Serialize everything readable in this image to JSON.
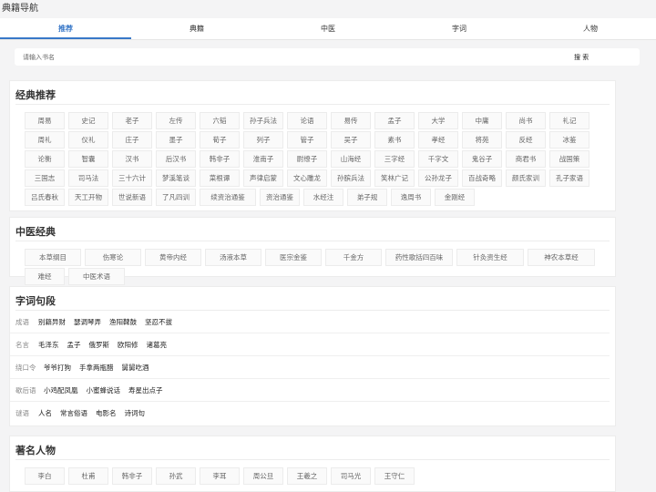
{
  "app": {
    "title": "典籍导航"
  },
  "tabs": [
    {
      "label": "推荐",
      "active": true
    },
    {
      "label": "典籍",
      "active": false
    },
    {
      "label": "中医",
      "active": false
    },
    {
      "label": "字词",
      "active": false
    },
    {
      "label": "人物",
      "active": false
    }
  ],
  "search": {
    "placeholder": "请输入书名",
    "button_label": "搜 索"
  },
  "classics": {
    "title": "经典推荐",
    "items": [
      "周易",
      "史记",
      "老子",
      "左传",
      "六韬",
      "孙子兵法",
      "论语",
      "易传",
      "孟子",
      "大学",
      "中庸",
      "尚书",
      "礼记",
      "周礼",
      "仪礼",
      "庄子",
      "墨子",
      "荀子",
      "列子",
      "管子",
      "吴子",
      "素书",
      "孝经",
      "将苑",
      "反经",
      "冰鉴",
      "论衡",
      "智囊",
      "汉书",
      "后汉书",
      "韩非子",
      "淮南子",
      "尉缭子",
      "山海经",
      "三字经",
      "千字文",
      "鬼谷子",
      "商君书",
      "战国策",
      "三国志",
      "司马法",
      "三十六计",
      "梦溪笔谈",
      "菜根谭",
      "声律启蒙",
      "文心雕龙",
      "孙膑兵法",
      "笑林广记",
      "公孙龙子",
      "百战奇略",
      "颜氏家训",
      "孔子家语",
      "吕氏春秋",
      "天工开物",
      "世说新语",
      "了凡四训",
      "续资治通鉴",
      "资治通鉴",
      "水经注",
      "弟子规",
      "逸周书",
      "金刚经"
    ],
    "wide": [
      "续资治通鉴"
    ]
  },
  "tcm": {
    "title": "中医经典",
    "items": [
      "本草纲目",
      "伤寒论",
      "黄帝内经",
      "汤液本草",
      "医宗金鉴",
      "千金方",
      "药性歌括四百味",
      "针灸资生经",
      "神农本草经",
      "难经",
      "中医术语"
    ]
  },
  "phrases": {
    "title": "字词句段",
    "rows": [
      {
        "label": "成语",
        "items": [
          "别籍异财",
          "瑟调琴弄",
          "渔阳鞞鼓",
          "坚忍不拔"
        ]
      },
      {
        "label": "名言",
        "items": [
          "毛泽东",
          "孟子",
          "俄罗斯",
          "欧阳修",
          "诸葛亮"
        ]
      },
      {
        "label": "绕口令",
        "items": [
          "爷爷打狗",
          "手拿两瓶醋",
          "舅舅吃酒"
        ]
      },
      {
        "label": "歇后语",
        "items": [
          "小鸡配凤凰",
          "小蜜蜂说话",
          "寿星出点子"
        ]
      },
      {
        "label": "谜语",
        "items": [
          "人名",
          "常言俗语",
          "电影名",
          "诗词句"
        ]
      }
    ]
  },
  "people": {
    "title": "著名人物",
    "items": [
      "李白",
      "杜甫",
      "韩非子",
      "孙武",
      "李耳",
      "周公旦",
      "王羲之",
      "司马光",
      "王守仁"
    ]
  }
}
